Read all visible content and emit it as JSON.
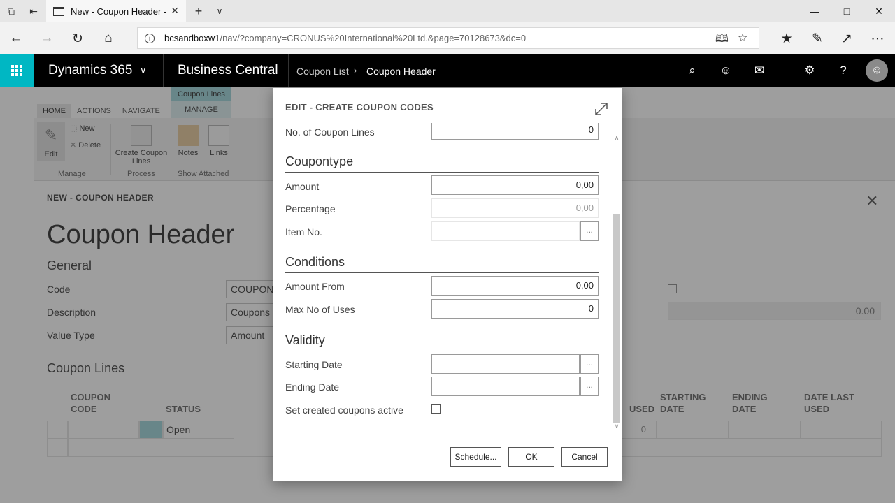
{
  "browser": {
    "tab_title": "New - Coupon Header -",
    "url_host": "bcsandboxw1",
    "url_rest": "/nav/?company=CRONUS%20International%20Ltd.&page=70128673&dc=0"
  },
  "app": {
    "brand": "Dynamics 365",
    "product": "Business Central",
    "breadcrumb": [
      "Coupon List",
      "Coupon Header"
    ]
  },
  "ribbon": {
    "tabs": [
      "HOME",
      "ACTIONS",
      "NAVIGATE"
    ],
    "context_title": "Coupon Lines",
    "context_tab": "MANAGE",
    "buttons": {
      "edit": "Edit",
      "new": "New",
      "delete": "Delete",
      "create_coupon_lines": "Create Coupon Lines",
      "notes": "Notes",
      "links": "Links"
    },
    "groups": {
      "manage": "Manage",
      "process": "Process",
      "show_attached": "Show Attached"
    }
  },
  "card": {
    "small_title": "NEW - COUPON HEADER",
    "big_title": "Coupon Header",
    "general": "General",
    "fields": [
      {
        "label": "Code",
        "value": "COUPONS"
      },
      {
        "label": "Description",
        "value": "Coupons"
      },
      {
        "label": "Value Type",
        "value": "Amount"
      }
    ],
    "right_value": "0.00",
    "lines_title": "Coupon Lines",
    "grid_headers": {
      "coupon_code": "COUPON CODE",
      "status": "STATUS",
      "used": "USED",
      "starting_date": "STARTING DATE",
      "ending_date": "ENDING DATE",
      "date_last_used": "DATE LAST USED"
    },
    "grid_row": {
      "status": "Open",
      "used": "0"
    }
  },
  "dialog": {
    "title": "EDIT - CREATE COUPON CODES",
    "partial_label": "No. of Coupon Lines",
    "partial_value": "0",
    "sections": {
      "coupontype": "Coupontype",
      "conditions": "Conditions",
      "validity": "Validity"
    },
    "fields": {
      "amount": {
        "label": "Amount",
        "value": "0,00"
      },
      "percentage": {
        "label": "Percentage",
        "value": "0,00"
      },
      "item_no": {
        "label": "Item No.",
        "value": ""
      },
      "amount_from": {
        "label": "Amount From",
        "value": "0,00"
      },
      "max_no_of_uses": {
        "label": "Max No of Uses",
        "value": "0"
      },
      "starting_date": {
        "label": "Starting Date",
        "value": ""
      },
      "ending_date": {
        "label": "Ending Date",
        "value": ""
      },
      "set_active": {
        "label": "Set created coupons active",
        "checked": false
      }
    },
    "assist_label": "...",
    "buttons": {
      "schedule": "Schedule...",
      "ok": "OK",
      "cancel": "Cancel"
    }
  }
}
